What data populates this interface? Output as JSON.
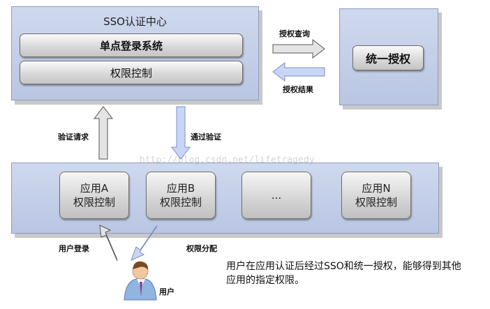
{
  "sso": {
    "title": "SSO认证中心",
    "single_signon": "单点登录系统",
    "permission_control": "权限控制"
  },
  "auth": {
    "unified_auth": "统一授权"
  },
  "arrows": {
    "auth_query": "授权查询",
    "auth_result": "授权结果",
    "verify_request": "验证请求",
    "pass_verify": "通过验证",
    "user_login": "用户登录",
    "permission_assign": "权限分配"
  },
  "apps": [
    {
      "name": "应用A",
      "sub": "权限控制"
    },
    {
      "name": "应用B",
      "sub": "权限控制"
    },
    {
      "name": "...",
      "sub": ""
    },
    {
      "name": "应用N",
      "sub": "权限控制"
    }
  ],
  "user": {
    "label": "用户"
  },
  "note": "用户在应用认证后经过SSO和统一授权，能够得到其他应用的指定权限。",
  "watermark": "http://blog.csdn.net/lifetragedy",
  "colors": {
    "panel": "#c4cfe8",
    "gray_arrow": "#e4e4e4",
    "blue_arrow": "#c8d6f5"
  }
}
